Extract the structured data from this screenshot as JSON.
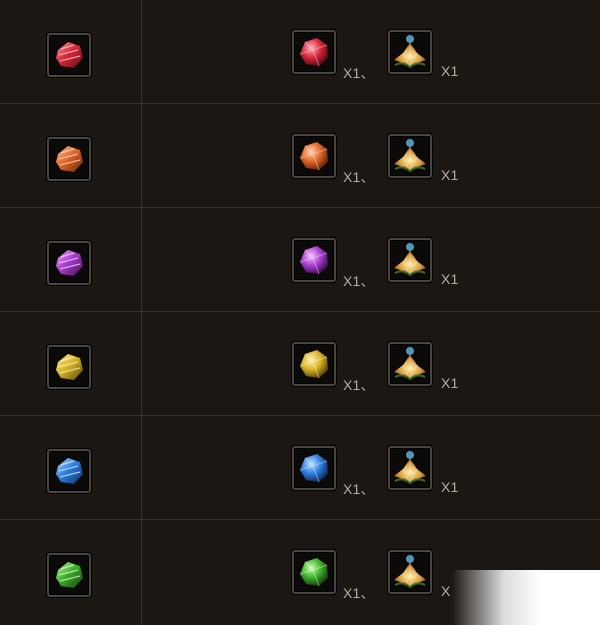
{
  "rows": [
    {
      "base_gem": "red-gem-shard-icon",
      "mat1": "red-gem-icon",
      "mat2": "golden-lotus-icon",
      "qty1": "X1、",
      "qty2": "X1",
      "color": "#d8283a"
    },
    {
      "base_gem": "orange-gem-shard-icon",
      "mat1": "orange-gem-icon",
      "mat2": "golden-lotus-icon",
      "qty1": "X1、",
      "qty2": "X1",
      "color": "#e2682a"
    },
    {
      "base_gem": "purple-gem-shard-icon",
      "mat1": "purple-gem-icon",
      "mat2": "golden-lotus-icon",
      "qty1": "X1、",
      "qty2": "X1",
      "color": "#a93fcf"
    },
    {
      "base_gem": "yellow-gem-shard-icon",
      "mat1": "yellow-gem-icon",
      "mat2": "golden-lotus-icon",
      "qty1": "X1、",
      "qty2": "X1",
      "color": "#d8b526"
    },
    {
      "base_gem": "blue-gem-shard-icon",
      "mat1": "blue-gem-icon",
      "mat2": "golden-lotus-icon",
      "qty1": "X1、",
      "qty2": "X1",
      "color": "#2f7fe0"
    },
    {
      "base_gem": "green-gem-shard-icon",
      "mat1": "green-gem-icon",
      "mat2": "golden-lotus-icon",
      "qty1": "X1、",
      "qty2": "X",
      "color": "#3fb12c"
    }
  ],
  "colors": {
    "background": "#1c1713",
    "grid_line": "#3a322b",
    "slot_border": "#4b4540",
    "text": "#b9b09f"
  }
}
